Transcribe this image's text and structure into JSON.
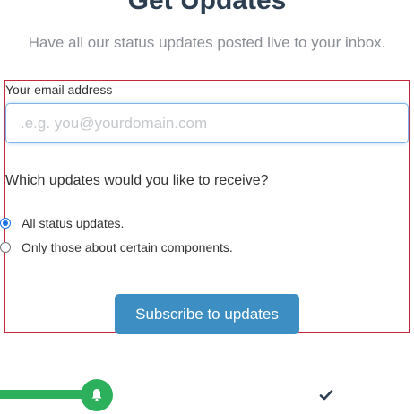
{
  "header": {
    "title": "Get Updates",
    "subtitle": "Have all our status updates posted live to your inbox."
  },
  "form": {
    "email_label": "Your email address",
    "email_placeholder": ".e.g. you@yourdomain.com",
    "email_value": "",
    "question": "Which updates would you like to receive?",
    "options": [
      {
        "label": "All status updates.",
        "selected": true
      },
      {
        "label": "Only those about certain components.",
        "selected": false
      }
    ],
    "submit_label": "Subscribe to updates"
  },
  "footer": {
    "progress_color": "#2db05c",
    "progress_icon": "bell-icon",
    "status_icon": "check-icon"
  },
  "colors": {
    "accent": "#3d8ec2",
    "border_highlight": "#c0273d",
    "progress": "#2db05c"
  }
}
